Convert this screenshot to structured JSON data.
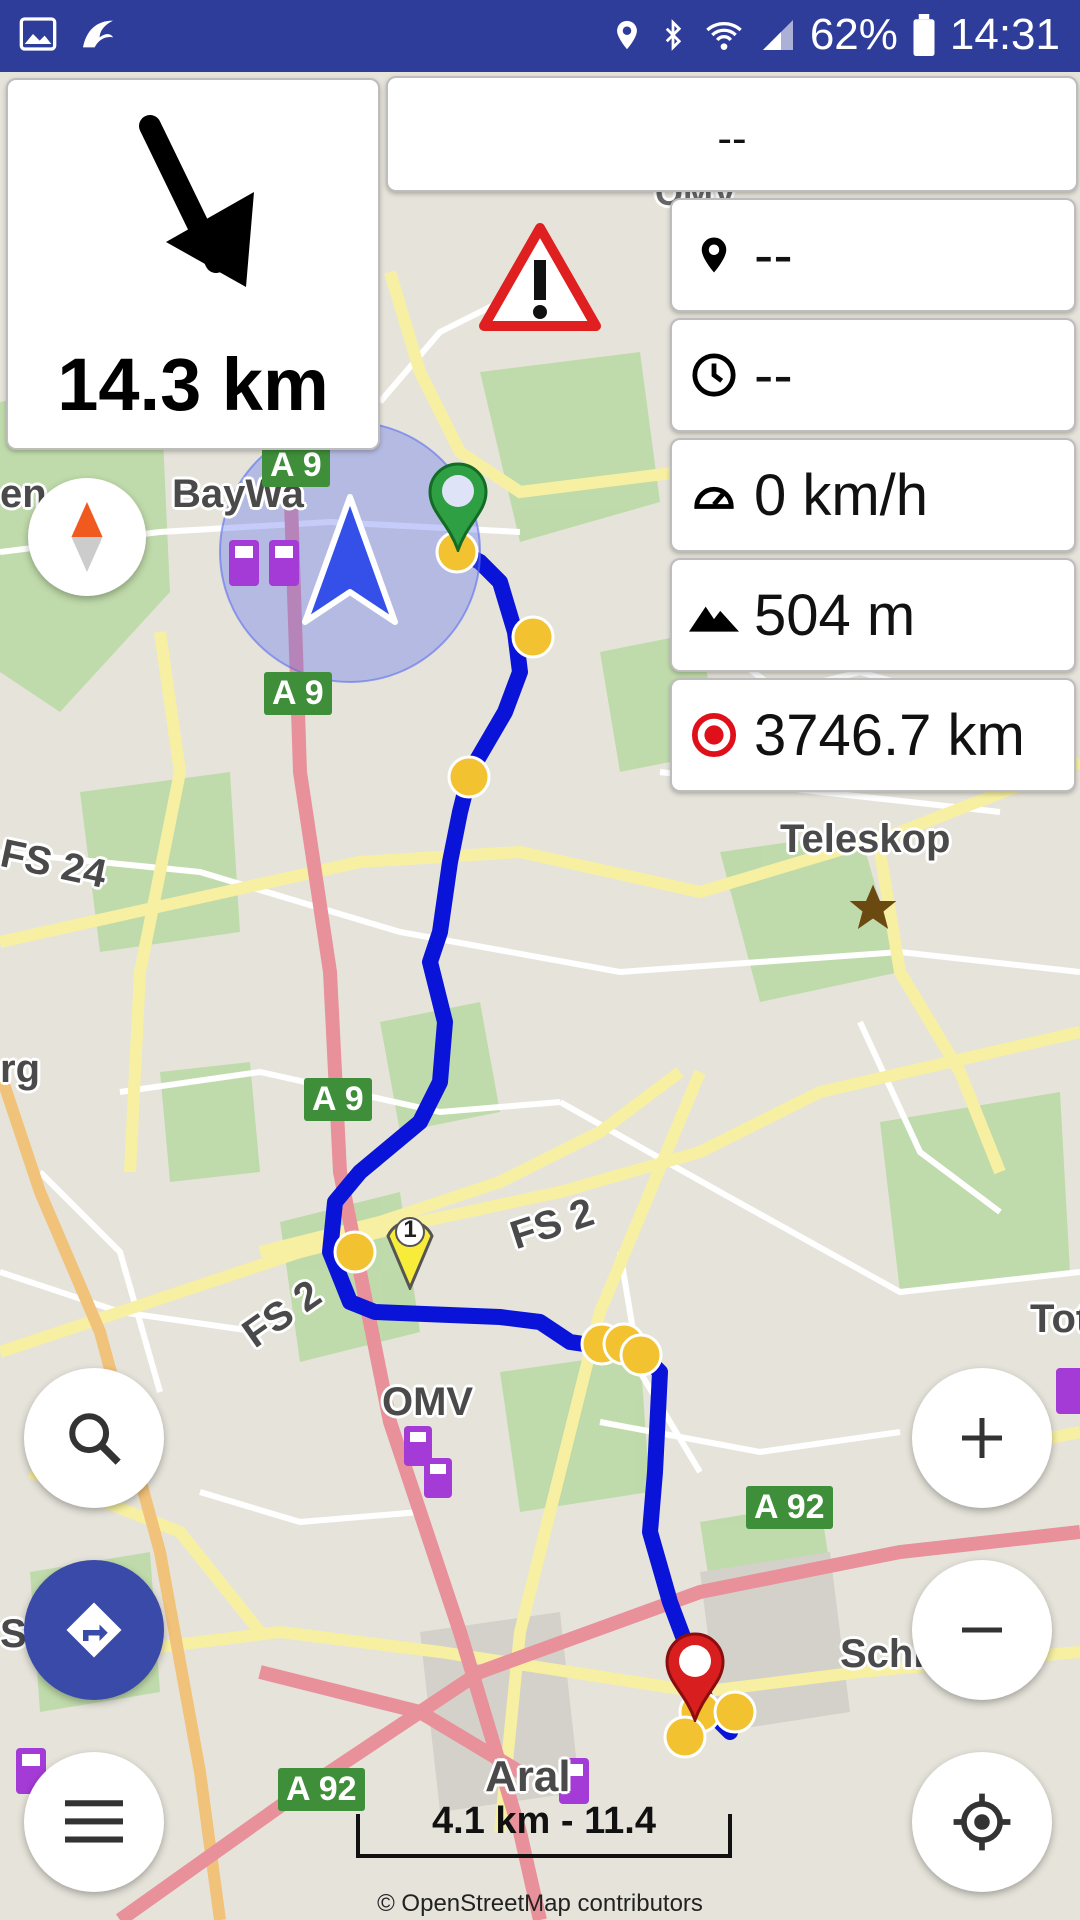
{
  "status_bar": {
    "battery_percent": "62%",
    "time": "14:31",
    "icons": [
      "image-icon",
      "app-icon",
      "location-icon",
      "bluetooth-icon",
      "wifi-icon",
      "signal-icon",
      "battery-icon"
    ]
  },
  "navigation": {
    "turn_direction": "arrow-down-right-icon",
    "distance_to_turn": "14.3 km",
    "street_name": "--"
  },
  "info_panels": {
    "destination": "--",
    "time": "--",
    "speed": "0 km/h",
    "altitude": "504 m",
    "recorded_distance": "3746.7 km"
  },
  "map": {
    "labels": {
      "omv_top": "OMV",
      "baywa": "BayWa",
      "teleskop": "Teleskop",
      "fs24": "FS 24",
      "fs2_a": "FS 2",
      "fs2_b": "FS 2",
      "omv_bottom": "OMV",
      "aral": "Aral",
      "schiederer": "Schiederer",
      "en_left": "en",
      "rg_left": "rg",
      "shel_left": "Shel",
      "tot_right": "Tot"
    },
    "shields": {
      "a9_top": "A 9",
      "a9_mid": "A 9",
      "a9_low": "A 9",
      "a92_right": "A 92",
      "a92_left": "A 92"
    },
    "waypoint_number": "1",
    "scale_label": "4.1 km - 11.4",
    "attribution": "© OpenStreetMap contributors",
    "colors": {
      "route": "#0a14d8",
      "waypoint": "#f2c230",
      "start": "#2ea043",
      "end": "#d81e1e"
    }
  },
  "buttons": {
    "compass": "compass-button",
    "search": "search-button",
    "directions": "directions-button",
    "menu": "menu-button",
    "zoom_in": "zoom-in-button",
    "zoom_out": "zoom-out-button",
    "my_location": "my-location-button"
  }
}
